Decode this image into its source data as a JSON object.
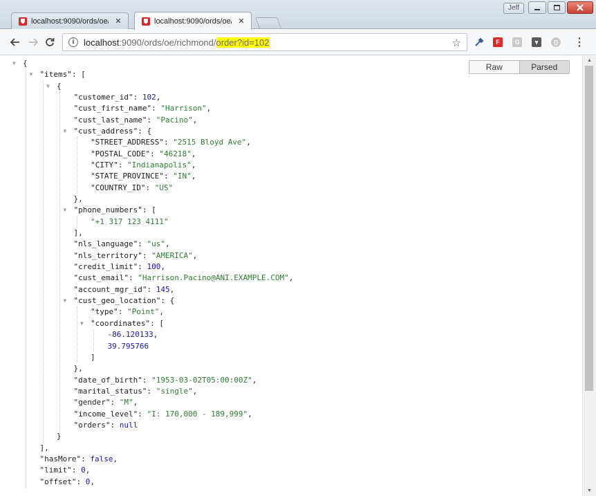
{
  "window": {
    "user_badge": "Jeff",
    "tabs": [
      {
        "title": "localhost:9090/ords/oe/r",
        "close": "✕"
      },
      {
        "title": "localhost:9090/ords/oe/r",
        "close": "✕"
      }
    ]
  },
  "toolbar": {
    "url_host": "localhost",
    "url_rest": ":9090/ords/oe/richmond/",
    "url_highlight": "order?id=102",
    "info_glyph": "i",
    "star_glyph": "☆",
    "menu_glyph": "⋮",
    "extensions": [
      {
        "name": "eyedropper-icon",
        "glyph": "",
        "color": "#3b5b93"
      },
      {
        "name": "flipboard-icon",
        "glyph": "F",
        "color": "#e02828"
      },
      {
        "name": "g-extension-icon",
        "glyph": "G",
        "color": "#c9c9c9"
      },
      {
        "name": "pocket-extension-icon",
        "glyph": "▾",
        "color": "#5a5a5a"
      },
      {
        "name": "json-extension-icon",
        "glyph": "{}",
        "color": "#c9c9c9"
      }
    ]
  },
  "viewer": {
    "raw_label": "Raw",
    "parsed_label": "Parsed",
    "lines": [
      {
        "d": 0,
        "tri": true,
        "parts": [
          [
            "p",
            "{"
          ]
        ]
      },
      {
        "d": 1,
        "tri": true,
        "parts": [
          [
            "k",
            "\"items\""
          ],
          [
            "p",
            ": ["
          ]
        ]
      },
      {
        "d": 2,
        "tri": true,
        "parts": [
          [
            "p",
            "{"
          ]
        ]
      },
      {
        "d": 3,
        "parts": [
          [
            "k",
            "\"customer_id\""
          ],
          [
            "p",
            ": "
          ],
          [
            "n",
            "102"
          ],
          [
            "p",
            ","
          ]
        ]
      },
      {
        "d": 3,
        "parts": [
          [
            "k",
            "\"cust_first_name\""
          ],
          [
            "p",
            ": "
          ],
          [
            "s",
            "\"Harrison\""
          ],
          [
            "p",
            ","
          ]
        ]
      },
      {
        "d": 3,
        "parts": [
          [
            "k",
            "\"cust_last_name\""
          ],
          [
            "p",
            ": "
          ],
          [
            "s",
            "\"Pacino\""
          ],
          [
            "p",
            ","
          ]
        ]
      },
      {
        "d": 3,
        "tri": true,
        "parts": [
          [
            "k",
            "\"cust_address\""
          ],
          [
            "p",
            ": {"
          ]
        ]
      },
      {
        "d": 4,
        "parts": [
          [
            "k",
            "\"STREET_ADDRESS\""
          ],
          [
            "p",
            ": "
          ],
          [
            "s",
            "\"2515 Bloyd Ave\""
          ],
          [
            "p",
            ","
          ]
        ]
      },
      {
        "d": 4,
        "parts": [
          [
            "k",
            "\"POSTAL_CODE\""
          ],
          [
            "p",
            ": "
          ],
          [
            "s",
            "\"46218\""
          ],
          [
            "p",
            ","
          ]
        ]
      },
      {
        "d": 4,
        "parts": [
          [
            "k",
            "\"CITY\""
          ],
          [
            "p",
            ": "
          ],
          [
            "s",
            "\"Indianapolis\""
          ],
          [
            "p",
            ","
          ]
        ]
      },
      {
        "d": 4,
        "parts": [
          [
            "k",
            "\"STATE_PROVINCE\""
          ],
          [
            "p",
            ": "
          ],
          [
            "s",
            "\"IN\""
          ],
          [
            "p",
            ","
          ]
        ]
      },
      {
        "d": 4,
        "parts": [
          [
            "k",
            "\"COUNTRY_ID\""
          ],
          [
            "p",
            ": "
          ],
          [
            "s",
            "\"US\""
          ]
        ]
      },
      {
        "d": 3,
        "parts": [
          [
            "p",
            "},"
          ]
        ]
      },
      {
        "d": 3,
        "tri": true,
        "parts": [
          [
            "k",
            "\"phone_numbers\""
          ],
          [
            "p",
            ": ["
          ]
        ]
      },
      {
        "d": 4,
        "parts": [
          [
            "s",
            "\"+1 317 123 4111\""
          ]
        ]
      },
      {
        "d": 3,
        "parts": [
          [
            "p",
            "],"
          ]
        ]
      },
      {
        "d": 3,
        "parts": [
          [
            "k",
            "\"nls_language\""
          ],
          [
            "p",
            ": "
          ],
          [
            "s",
            "\"us\""
          ],
          [
            "p",
            ","
          ]
        ]
      },
      {
        "d": 3,
        "parts": [
          [
            "k",
            "\"nls_territory\""
          ],
          [
            "p",
            ": "
          ],
          [
            "s",
            "\"AMERICA\""
          ],
          [
            "p",
            ","
          ]
        ]
      },
      {
        "d": 3,
        "parts": [
          [
            "k",
            "\"credit_limit\""
          ],
          [
            "p",
            ": "
          ],
          [
            "n",
            "100"
          ],
          [
            "p",
            ","
          ]
        ]
      },
      {
        "d": 3,
        "parts": [
          [
            "k",
            "\"cust_email\""
          ],
          [
            "p",
            ": "
          ],
          [
            "s",
            "\"Harrison.Pacino@ANI.EXAMPLE.COM\""
          ],
          [
            "p",
            ","
          ]
        ]
      },
      {
        "d": 3,
        "parts": [
          [
            "k",
            "\"account_mgr_id\""
          ],
          [
            "p",
            ": "
          ],
          [
            "n",
            "145"
          ],
          [
            "p",
            ","
          ]
        ]
      },
      {
        "d": 3,
        "tri": true,
        "parts": [
          [
            "k",
            "\"cust_geo_location\""
          ],
          [
            "p",
            ": {"
          ]
        ]
      },
      {
        "d": 4,
        "parts": [
          [
            "k",
            "\"type\""
          ],
          [
            "p",
            ": "
          ],
          [
            "s",
            "\"Point\""
          ],
          [
            "p",
            ","
          ]
        ]
      },
      {
        "d": 4,
        "tri": true,
        "parts": [
          [
            "k",
            "\"coordinates\""
          ],
          [
            "p",
            ": ["
          ]
        ]
      },
      {
        "d": 5,
        "parts": [
          [
            "n",
            "-86.120133"
          ],
          [
            "p",
            ","
          ]
        ]
      },
      {
        "d": 5,
        "parts": [
          [
            "n",
            "39.795766"
          ]
        ]
      },
      {
        "d": 4,
        "parts": [
          [
            "p",
            "]"
          ]
        ]
      },
      {
        "d": 3,
        "parts": [
          [
            "p",
            "},"
          ]
        ]
      },
      {
        "d": 3,
        "parts": [
          [
            "k",
            "\"date_of_birth\""
          ],
          [
            "p",
            ": "
          ],
          [
            "s",
            "\"1953-03-02T05:00:00Z\""
          ],
          [
            "p",
            ","
          ]
        ]
      },
      {
        "d": 3,
        "parts": [
          [
            "k",
            "\"marital_status\""
          ],
          [
            "p",
            ": "
          ],
          [
            "s",
            "\"single\""
          ],
          [
            "p",
            ","
          ]
        ]
      },
      {
        "d": 3,
        "parts": [
          [
            "k",
            "\"gender\""
          ],
          [
            "p",
            ": "
          ],
          [
            "s",
            "\"M\""
          ],
          [
            "p",
            ","
          ]
        ]
      },
      {
        "d": 3,
        "parts": [
          [
            "k",
            "\"income_level\""
          ],
          [
            "p",
            ": "
          ],
          [
            "s",
            "\"I: 170,000 - 189,999\""
          ],
          [
            "p",
            ","
          ]
        ]
      },
      {
        "d": 3,
        "parts": [
          [
            "k",
            "\"orders\""
          ],
          [
            "p",
            ": "
          ],
          [
            "n",
            "null"
          ]
        ]
      },
      {
        "d": 2,
        "parts": [
          [
            "p",
            "}"
          ]
        ]
      },
      {
        "d": 1,
        "parts": [
          [
            "p",
            "],"
          ]
        ]
      },
      {
        "d": 1,
        "parts": [
          [
            "k",
            "\"hasMore\""
          ],
          [
            "p",
            ": "
          ],
          [
            "n",
            "false"
          ],
          [
            "p",
            ","
          ]
        ]
      },
      {
        "d": 1,
        "parts": [
          [
            "k",
            "\"limit\""
          ],
          [
            "p",
            ": "
          ],
          [
            "n",
            "0"
          ],
          [
            "p",
            ","
          ]
        ]
      },
      {
        "d": 1,
        "parts": [
          [
            "k",
            "\"offset\""
          ],
          [
            "p",
            ": "
          ],
          [
            "n",
            "0"
          ],
          [
            "p",
            ","
          ]
        ]
      }
    ]
  },
  "scrollbar": {
    "up": "▲",
    "down": "▼"
  }
}
